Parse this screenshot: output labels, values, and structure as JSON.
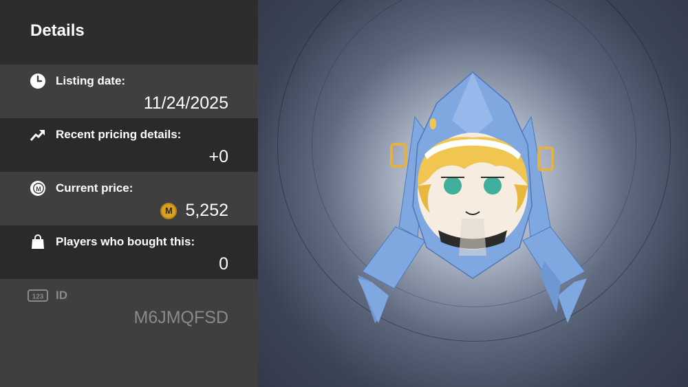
{
  "details": {
    "title": "Details",
    "rows": [
      {
        "icon": "clock-icon",
        "label": "Listing date:",
        "value": "11/24/2025"
      },
      {
        "icon": "trend-up-icon",
        "label": "Recent pricing details:",
        "value": "+0"
      },
      {
        "icon": "coin-m-icon",
        "label": "Current price:",
        "value": "5,252",
        "coin_symbol": "M"
      },
      {
        "icon": "shopping-bag-icon",
        "label": "Players who bought this:",
        "value": "0"
      },
      {
        "icon": "number-123-icon",
        "label": "ID",
        "value": "M6JMQFSD",
        "badge": "123"
      }
    ]
  },
  "preview": {
    "item": "character-mask-image",
    "colors": {
      "hood": "#7fa7e0",
      "hair": "#f0c650",
      "eyes": "#3fae9a",
      "coin": "#d9a21e"
    }
  }
}
